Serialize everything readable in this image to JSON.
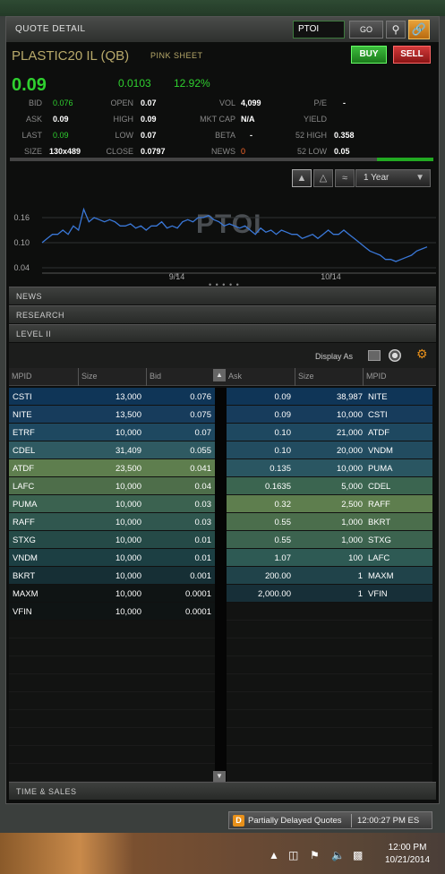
{
  "header": {
    "title": "QUOTE DETAIL",
    "symbol_input": "PTOI",
    "go_label": "GO"
  },
  "security": {
    "name": "PLASTIC20 IL (QB)",
    "market": "PINK SHEET"
  },
  "actions": {
    "buy": "BUY",
    "sell": "SELL"
  },
  "price": {
    "last": "0.09",
    "change": "0.0103",
    "change_pct": "12.92%"
  },
  "quote": {
    "bid_l": "BID",
    "bid": "0.076",
    "ask_l": "ASK",
    "ask": "0.09",
    "last_l": "LAST",
    "last": "0.09",
    "size_l": "SIZE",
    "size": "130x489",
    "open_l": "OPEN",
    "open": "0.07",
    "high_l": "HIGH",
    "high": "0.09",
    "low_l": "LOW",
    "low": "0.07",
    "close_l": "CLOSE",
    "close": "0.0797",
    "vol_l": "VOL",
    "vol": "4,099",
    "mktcap_l": "MKT CAP",
    "mktcap": "N/A",
    "beta_l": "BETA",
    "beta": "-",
    "news_l": "NEWS",
    "news": "0",
    "pe_l": "P/E",
    "pe": "-",
    "yield_l": "YIELD",
    "yield": "",
    "hi52_l": "52 HIGH",
    "hi52": "0.358",
    "lo52_l": "52 LOW",
    "lo52": "0.05"
  },
  "chart": {
    "period": "1 Year",
    "watermark": "PTOI",
    "y_ticks": [
      "0.16",
      "0.10",
      "0.04"
    ],
    "x_ticks": [
      "9/14",
      "10/14"
    ],
    "color": "#3a78d8"
  },
  "chart_data": {
    "type": "line",
    "ylim": [
      0.04,
      0.19
    ],
    "x_ticks": [
      "9/14",
      "10/14"
    ],
    "y_ticks": [
      0.16,
      0.1,
      0.04
    ],
    "series": [
      {
        "values": [
          0.1,
          0.11,
          0.12,
          0.12,
          0.13,
          0.12,
          0.14,
          0.13,
          0.18,
          0.15,
          0.16,
          0.155,
          0.15,
          0.155,
          0.15,
          0.14,
          0.14,
          0.145,
          0.135,
          0.14,
          0.13,
          0.14,
          0.14,
          0.15,
          0.135,
          0.14,
          0.135,
          0.15,
          0.155,
          0.15,
          0.16,
          0.16,
          0.165,
          0.155,
          0.15,
          0.14,
          0.145,
          0.14,
          0.135,
          0.14,
          0.13,
          0.12,
          0.135,
          0.125,
          0.13,
          0.12,
          0.13,
          0.125,
          0.12,
          0.12,
          0.11,
          0.115,
          0.12,
          0.11,
          0.12,
          0.13,
          0.12,
          0.12,
          0.13,
          0.12,
          0.11,
          0.1,
          0.09,
          0.08,
          0.075,
          0.07,
          0.06,
          0.06,
          0.055,
          0.06,
          0.065,
          0.07,
          0.08,
          0.085,
          0.09
        ]
      }
    ]
  },
  "sections": {
    "news": "NEWS",
    "research": "RESEARCH",
    "level2": "LEVEL II",
    "time_sales": "TIME & SALES"
  },
  "level2": {
    "display_as": "Display As",
    "columns": {
      "mpid": "MPID",
      "size": "Size",
      "bid": "Bid",
      "ask": "Ask",
      "size2": "Size",
      "mpid2": "MPID"
    },
    "bids": [
      {
        "mpid": "CSTI",
        "size": "13,000",
        "bid": "0.076",
        "color": "#0f3557"
      },
      {
        "mpid": "NITE",
        "size": "13,500",
        "bid": "0.075",
        "color": "#173c5c"
      },
      {
        "mpid": "ETRF",
        "size": "10,000",
        "bid": "0.07",
        "color": "#1e4860"
      },
      {
        "mpid": "CDEL",
        "size": "31,409",
        "bid": "0.055",
        "color": "#2f5a62"
      },
      {
        "mpid": "ATDF",
        "size": "23,500",
        "bid": "0.041",
        "color": "#5e7e4e"
      },
      {
        "mpid": "LAFC",
        "size": "10,000",
        "bid": "0.04",
        "color": "#4e6e4a"
      },
      {
        "mpid": "PUMA",
        "size": "10,000",
        "bid": "0.03",
        "color": "#3b6250"
      },
      {
        "mpid": "RAFF",
        "size": "10,000",
        "bid": "0.03",
        "color": "#30574f"
      },
      {
        "mpid": "STXG",
        "size": "10,000",
        "bid": "0.01",
        "color": "#254a47"
      },
      {
        "mpid": "VNDM",
        "size": "10,000",
        "bid": "0.01",
        "color": "#1c3f43"
      },
      {
        "mpid": "BKRT",
        "size": "10,000",
        "bid": "0.001",
        "color": "#162f35"
      },
      {
        "mpid": "MAXM",
        "size": "10,000",
        "bid": "0.0001",
        "color": "#0f1414"
      },
      {
        "mpid": "VFIN",
        "size": "10,000",
        "bid": "0.0001",
        "color": "#0f1414"
      }
    ],
    "asks": [
      {
        "ask": "0.09",
        "size": "38,987",
        "mpid": "NITE",
        "color": "#0f3557"
      },
      {
        "ask": "0.09",
        "size": "10,000",
        "mpid": "CSTI",
        "color": "#173c5c"
      },
      {
        "ask": "0.10",
        "size": "21,000",
        "mpid": "ATDF",
        "color": "#1e4860"
      },
      {
        "ask": "0.10",
        "size": "20,000",
        "mpid": "VNDM",
        "color": "#224c60"
      },
      {
        "ask": "0.135",
        "size": "10,000",
        "mpid": "PUMA",
        "color": "#2a5662"
      },
      {
        "ask": "0.1635",
        "size": "5,000",
        "mpid": "CDEL",
        "color": "#3b6550"
      },
      {
        "ask": "0.32",
        "size": "2,500",
        "mpid": "RAFF",
        "color": "#5e7e4e"
      },
      {
        "ask": "0.55",
        "size": "1,000",
        "mpid": "BKRT",
        "color": "#4b6e4c"
      },
      {
        "ask": "0.55",
        "size": "1,000",
        "mpid": "STXG",
        "color": "#3c634f"
      },
      {
        "ask": "1.07",
        "size": "100",
        "mpid": "LAFC",
        "color": "#2e5a54"
      },
      {
        "ask": "200.00",
        "size": "1",
        "mpid": "MAXM",
        "color": "#20434a"
      },
      {
        "ask": "2,000.00",
        "size": "1",
        "mpid": "VFIN",
        "color": "#172f38"
      }
    ]
  },
  "status": {
    "badge": "D",
    "message": "Partially Delayed Quotes",
    "time": "12:00:27 PM ES"
  },
  "taskbar": {
    "time": "12:00 PM",
    "date": "10/21/2014"
  }
}
